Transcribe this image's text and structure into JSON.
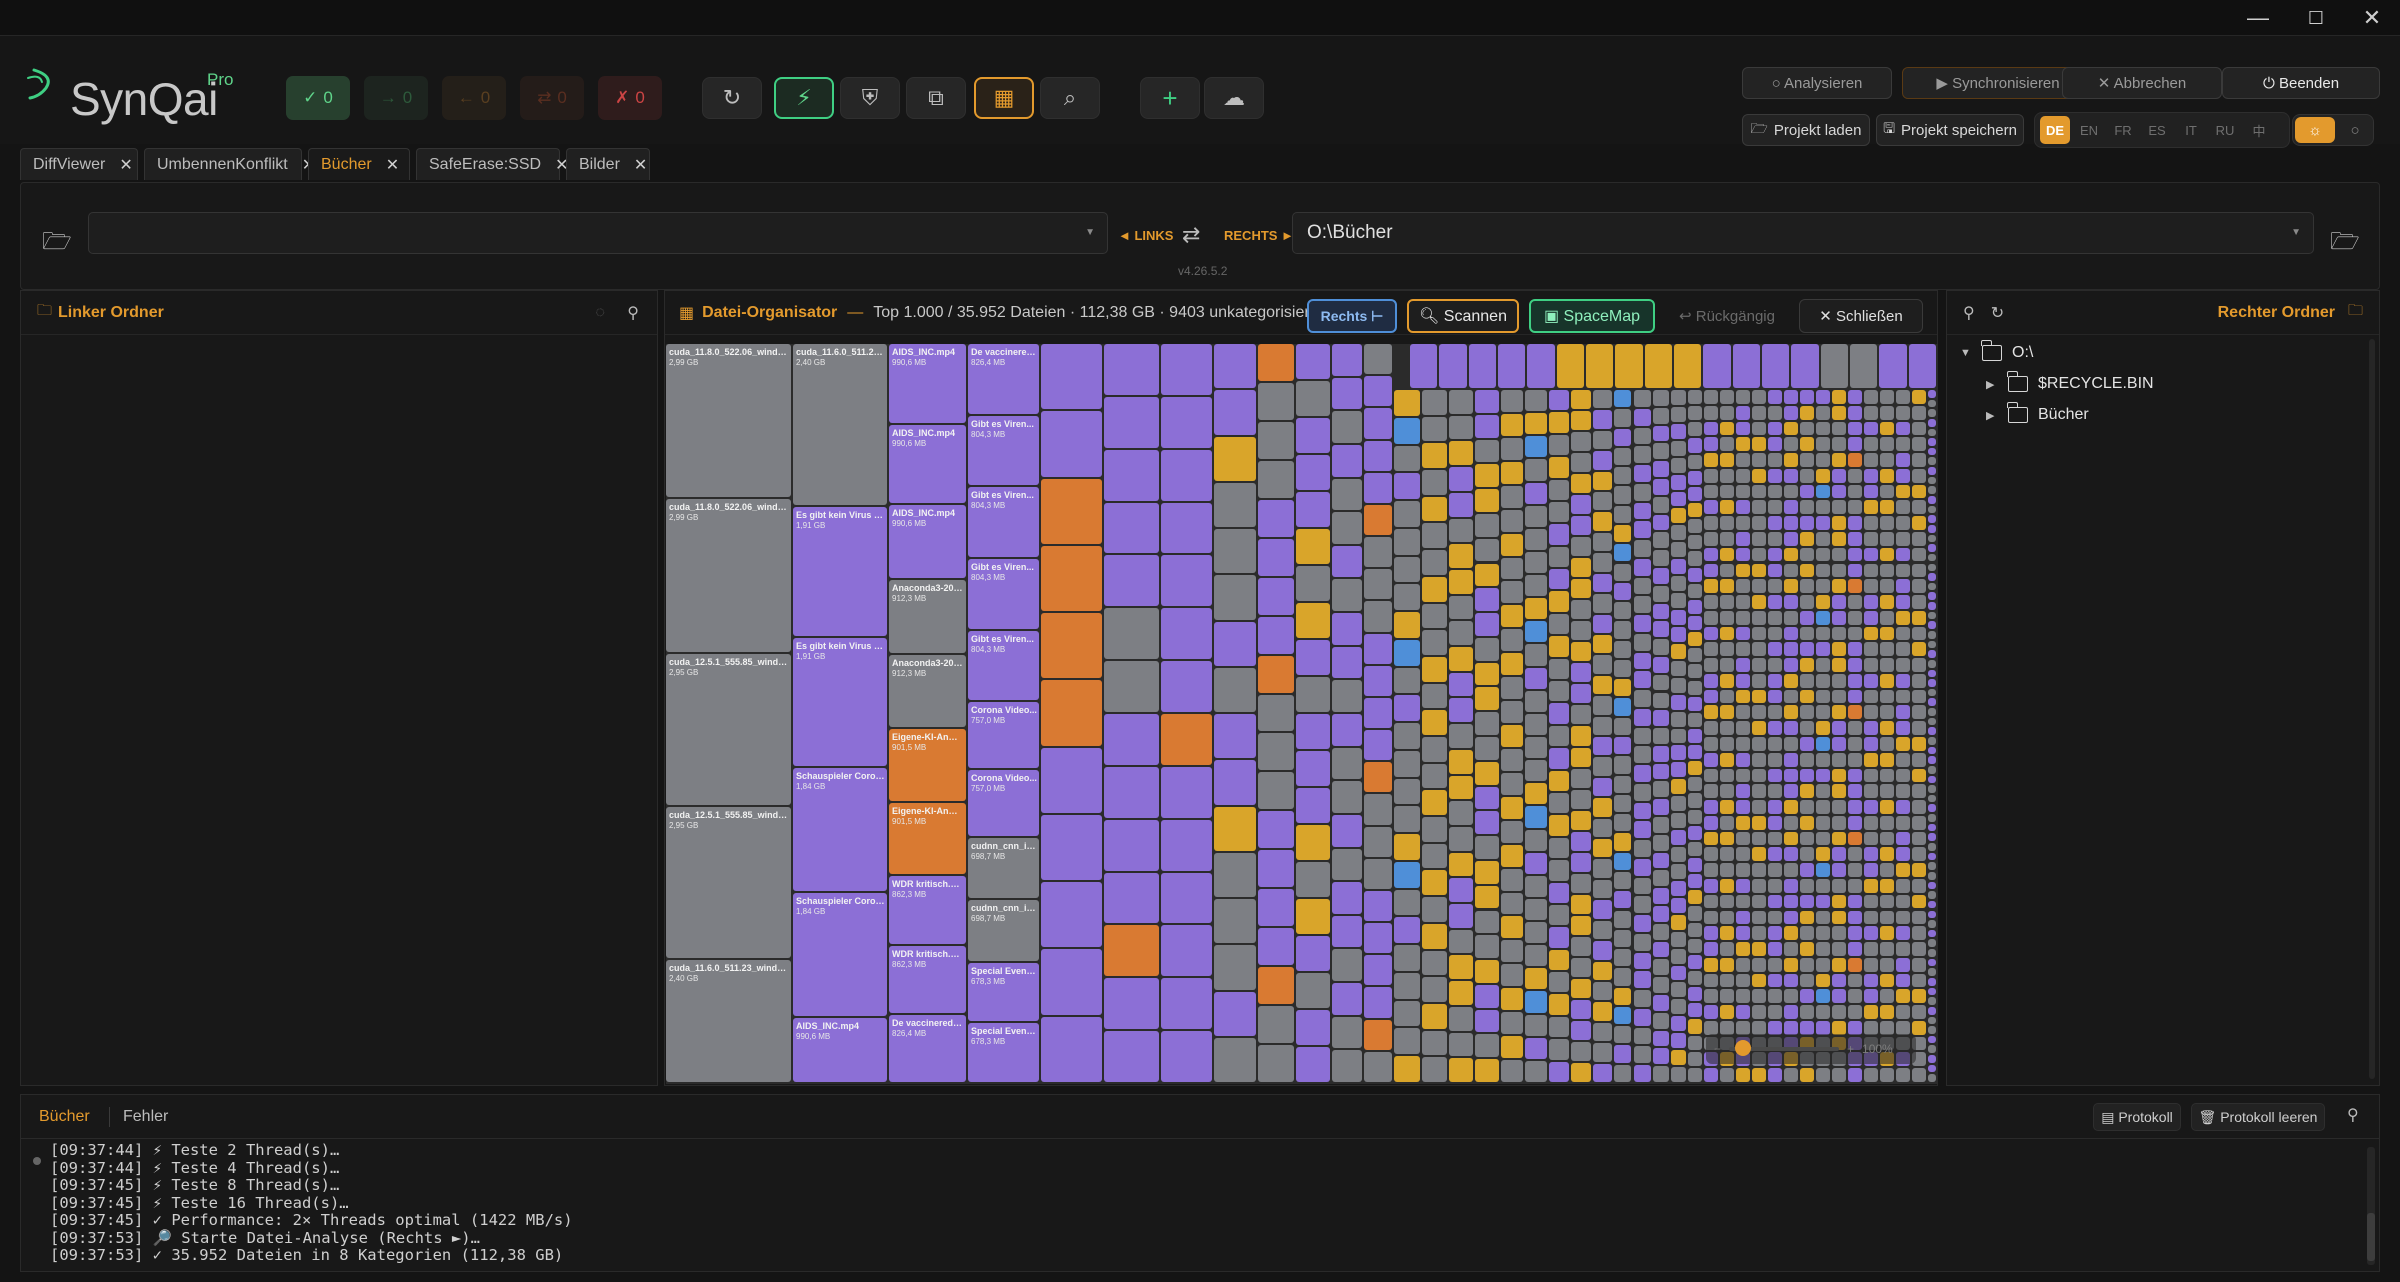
{
  "app": {
    "logo_text": "SynQai",
    "logo_edition": "Pro"
  },
  "window_controls": {
    "minimize": "—",
    "maximize": "☐",
    "close": "✕"
  },
  "status_counters": [
    {
      "symbol": "✓",
      "value": "0",
      "color": "#5fd48a",
      "bg": "#27402e"
    },
    {
      "symbol": "→",
      "value": "0",
      "color": "#2d5a3b",
      "bg": "#1d241f"
    },
    {
      "symbol": "←",
      "value": "0",
      "color": "#5a3f20",
      "bg": "#241f19"
    },
    {
      "symbol": "⇄",
      "value": "0",
      "color": "#5a2e20",
      "bg": "#241c19"
    },
    {
      "symbol": "✗",
      "value": "0",
      "color": "#c44",
      "bg": "#2f1c1c"
    }
  ],
  "toolbar_icons": [
    {
      "name": "refresh-icon",
      "glyph": "↻"
    },
    {
      "name": "wand-icon",
      "glyph": "⚡"
    },
    {
      "name": "shield-check-icon",
      "glyph": "⛨"
    },
    {
      "name": "duplicate-icon",
      "glyph": "⧉"
    },
    {
      "name": "organizer-icon",
      "glyph": "▦"
    },
    {
      "name": "search-doc-icon",
      "glyph": "⌕"
    },
    {
      "name": "add-icon",
      "glyph": "+"
    },
    {
      "name": "cloud-icon",
      "glyph": "☁"
    }
  ],
  "actions": {
    "analyze": "○ Analysieren",
    "sync": "▶ Synchronisieren",
    "abort": "✕ Abbrechen",
    "quit": "⏻ Beenden",
    "load_project": "Projekt laden",
    "save_project": "Projekt speichern"
  },
  "languages": [
    "DE",
    "EN",
    "FR",
    "ES",
    "IT",
    "RU",
    "中"
  ],
  "active_language": "DE",
  "tabs": [
    {
      "label": "DiffViewer",
      "active": false
    },
    {
      "label": "UmbennenKonflikt",
      "active": false
    },
    {
      "label": "Bücher",
      "active": true
    },
    {
      "label": "SafeErase:SSD",
      "active": false
    },
    {
      "label": "Bilder",
      "active": false
    }
  ],
  "paths": {
    "left": "",
    "right": "O:\\Bücher",
    "left_label": "◄ LINKS",
    "right_label": "RECHTS ►",
    "version": "v4.26.5.2"
  },
  "left_panel": {
    "title": "Linker Ordner"
  },
  "right_panel": {
    "title": "Rechter Ordner",
    "tree": [
      {
        "label": "O:\\",
        "level": 0,
        "arrow": "▼"
      },
      {
        "label": "$RECYCLE.BIN",
        "level": 1,
        "arrow": "▶"
      },
      {
        "label": "Bücher",
        "level": 1,
        "arrow": "▶"
      }
    ]
  },
  "organizer": {
    "title": "Datei-Organisator",
    "separator": "—",
    "summary": "Top 1.000 / 35.952 Dateien · 112,38 GB · 9403 unkategorisiert",
    "side_button": "Rechts ⊢",
    "scan_button": "Scannen",
    "spacemap_button": "SpaceMap",
    "undo_button": "↩ Rückgängig",
    "close_button": "✕ Schließen"
  },
  "colors": {
    "gray": "#7d7f84",
    "purple": "#8c6fd6",
    "orange": "#d97a32",
    "yellow": "#d9a52a",
    "blue": "#4f8fd8",
    "accent": "#e39a2d",
    "green": "#3fcf83"
  },
  "treemap": {
    "labeled_columns": [
      {
        "width": 127,
        "cells": [
          {
            "name": "cuda_11.8.0_522.06_windo...",
            "size": "2,99 GB",
            "cat": "gray",
            "h": 152
          },
          {
            "name": "cuda_11.8.0_522.06_windo...",
            "size": "2,99 GB",
            "cat": "gray",
            "h": 152
          },
          {
            "name": "cuda_12.5.1_555.85_windo...",
            "size": "2,95 GB",
            "cat": "gray",
            "h": 150
          },
          {
            "name": "cuda_12.5.1_555.85_windo...",
            "size": "2,95 GB",
            "cat": "gray",
            "h": 150
          },
          {
            "name": "cuda_11.6.0_511.23_window...",
            "size": "2,40 GB",
            "cat": "gray",
            "h": 122
          }
        ]
      },
      {
        "width": 96,
        "cells": [
          {
            "name": "cuda_11.6.0_511.23_w...",
            "size": "2,40 GB",
            "cat": "gray",
            "h": 162
          },
          {
            "name": "Es gibt kein Virus zu...",
            "size": "1,91 GB",
            "cat": "purple",
            "h": 130
          },
          {
            "name": "Es gibt kein Virus zu...",
            "size": "1,91 GB",
            "cat": "purple",
            "h": 130
          },
          {
            "name": "Schauspieler Corona...",
            "size": "1,84 GB",
            "cat": "purple",
            "h": 124
          },
          {
            "name": "Schauspieler Corona...",
            "size": "1,84 GB",
            "cat": "purple",
            "h": 124
          },
          {
            "name": "AIDS_INC.mp4",
            "size": "990,6 MB",
            "cat": "purple",
            "h": 66
          }
        ]
      },
      {
        "width": 79,
        "cells": [
          {
            "name": "AIDS_INC.mp4",
            "size": "990,6 MB",
            "cat": "purple",
            "h": 80
          },
          {
            "name": "AIDS_INC.mp4",
            "size": "990,6 MB",
            "cat": "purple",
            "h": 80
          },
          {
            "name": "AIDS_INC.mp4",
            "size": "990,6 MB",
            "cat": "purple",
            "h": 74
          },
          {
            "name": "Anaconda3-202...",
            "size": "912,3 MB",
            "cat": "gray",
            "h": 74
          },
          {
            "name": "Anaconda3-202...",
            "size": "912,3 MB",
            "cat": "gray",
            "h": 74
          },
          {
            "name": "Eigene-KI-Anwe...",
            "size": "901,5 MB",
            "cat": "orange",
            "h": 73
          },
          {
            "name": "Eigene-KI-Anwe...",
            "size": "901,5 MB",
            "cat": "orange",
            "h": 73
          },
          {
            "name": "WDR kritisch.mp4",
            "size": "862,3 MB",
            "cat": "purple",
            "h": 69
          },
          {
            "name": "WDR kritisch.mp4",
            "size": "862,3 MB",
            "cat": "purple",
            "h": 69
          },
          {
            "name": "De vaccinerede...",
            "size": "826,4 MB",
            "cat": "purple",
            "h": 68
          }
        ]
      },
      {
        "width": 73,
        "cells": [
          {
            "name": "De vaccinered...",
            "size": "826,4 MB",
            "cat": "purple",
            "h": 71
          },
          {
            "name": "Gibt es Viren...",
            "size": "804,3 MB",
            "cat": "purple",
            "h": 71
          },
          {
            "name": "Gibt es Viren...",
            "size": "804,3 MB",
            "cat": "purple",
            "h": 71
          },
          {
            "name": "Gibt es Viren...",
            "size": "804,3 MB",
            "cat": "purple",
            "h": 71
          },
          {
            "name": "Gibt es Viren...",
            "size": "804,3 MB",
            "cat": "purple",
            "h": 71
          },
          {
            "name": "Corona Video...",
            "size": "757,0 MB",
            "cat": "purple",
            "h": 67
          },
          {
            "name": "Corona Video...",
            "size": "757,0 MB",
            "cat": "purple",
            "h": 67
          },
          {
            "name": "cudnn_cnn_inf...",
            "size": "698,7 MB",
            "cat": "gray",
            "h": 62
          },
          {
            "name": "cudnn_cnn_inf...",
            "size": "698,7 MB",
            "cat": "gray",
            "h": 62
          },
          {
            "name": "Special Event...",
            "size": "678,3 MB",
            "cat": "purple",
            "h": 60
          },
          {
            "name": "Special Event...",
            "size": "678,3 MB",
            "cat": "purple",
            "h": 60
          }
        ]
      }
    ],
    "unlabeled_columns": [
      {
        "width": 63,
        "cells": [
          "purple",
          "purple",
          "orange",
          "orange",
          "orange",
          "orange",
          "purple",
          "purple",
          "purple",
          "purple",
          "purple"
        ]
      },
      {
        "width": 57,
        "cells": [
          "purple",
          "purple",
          "purple",
          "purple",
          "purple",
          "gray",
          "gray",
          "purple",
          "purple",
          "purple",
          "purple",
          "orange",
          "purple",
          "purple"
        ]
      },
      {
        "width": 53,
        "cells": [
          "purple",
          "purple",
          "purple",
          "purple",
          "purple",
          "purple",
          "purple",
          "orange",
          "purple",
          "purple",
          "purple",
          "purple",
          "purple",
          "purple"
        ]
      }
    ],
    "small_cells": [
      "purple",
      "gray",
      "purple",
      "purple",
      "yellow",
      "gray",
      "purple",
      "purple",
      "gray",
      "yellow",
      "purple",
      "gray",
      "gray",
      "purple",
      "yellow",
      "purple",
      "gray",
      "gray",
      "purple",
      "gray",
      "yellow",
      "yellow",
      "gray",
      "purple",
      "gray",
      "gray",
      "purple",
      "purple",
      "gray",
      "yellow",
      "gray",
      "gray",
      "purple",
      "orange",
      "gray",
      "gray",
      "yellow",
      "purple",
      "gray",
      "gray",
      "gray",
      "yellow",
      "purple",
      "gray",
      "yellow",
      "gray",
      "gray",
      "purple",
      "purple",
      "gray",
      "gray",
      "gray",
      "yellow",
      "gray",
      "purple",
      "gray",
      "yellow",
      "yellow",
      "gray",
      "gray",
      "purple",
      "gray",
      "gray",
      "gray",
      "purple",
      "yellow",
      "gray",
      "gray",
      "purple",
      "gray",
      "gray",
      "yellow",
      "gray",
      "purple",
      "gray",
      "blue",
      "gray",
      "yellow",
      "purple",
      "gray"
    ],
    "top_strip": [
      "purple",
      "purple",
      "purple",
      "purple",
      "purple",
      "yellow",
      "yellow",
      "yellow",
      "yellow",
      "yellow",
      "purple",
      "purple",
      "purple",
      "purple",
      "gray",
      "gray",
      "purple",
      "purple"
    ]
  },
  "zoom": {
    "minus": "−",
    "plus": "+",
    "value": "100%"
  },
  "bottom": {
    "tabs": [
      "Bücher",
      "Fehler"
    ],
    "protocol_button": "Protokoll",
    "clear_protocol_button": "Protokoll leeren",
    "log_lines": [
      "[09:37:44] ⚡ Teste 2 Thread(s)…",
      "[09:37:44] ⚡ Teste 4 Thread(s)…",
      "[09:37:45] ⚡ Teste 8 Thread(s)…",
      "[09:37:45] ⚡ Teste 16 Thread(s)…",
      "[09:37:45] ✓ Performance: 2× Threads optimal (1422 MB/s)",
      "[09:37:53] 🔎 Starte Datei-Analyse (Rechts ►)…",
      "[09:37:53] ✓ 35.952 Dateien in 8 Kategorien (112,38 GB)"
    ]
  }
}
